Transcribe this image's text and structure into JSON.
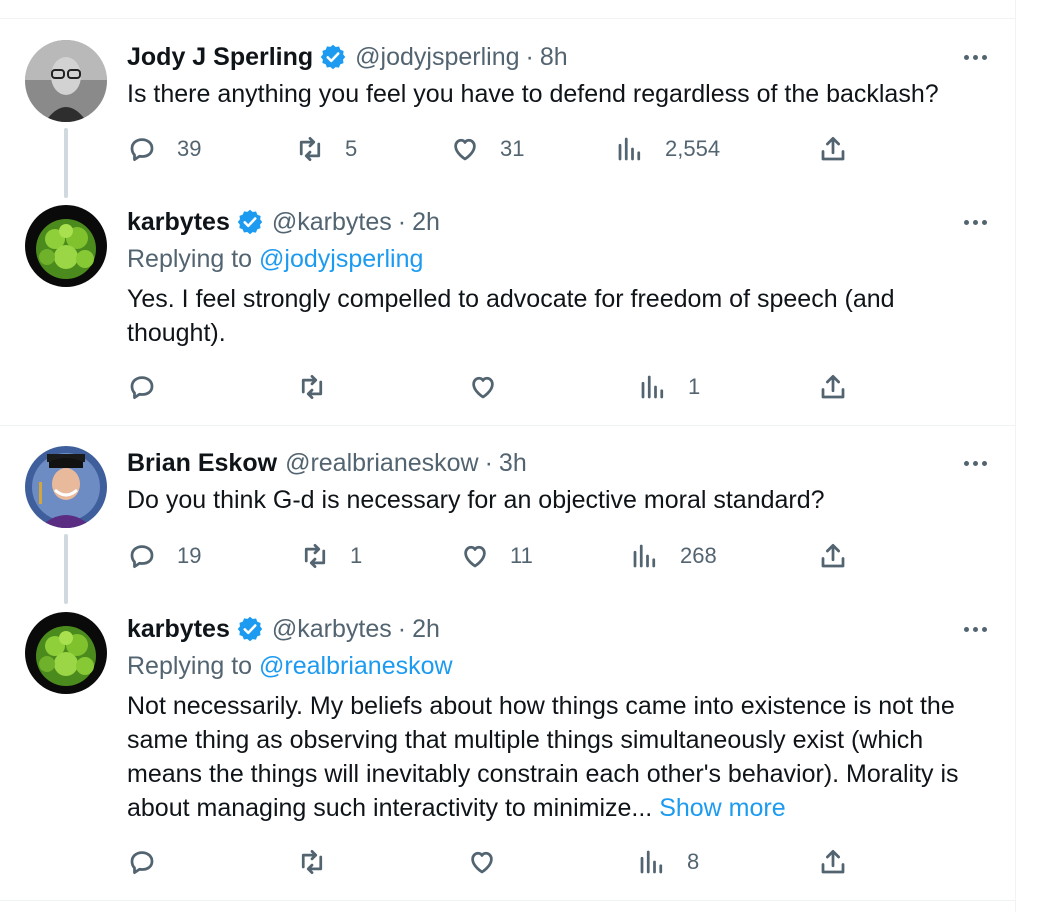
{
  "colors": {
    "link": "#1d9bf0",
    "secondary": "#536471",
    "text": "#0f1419",
    "verified": "#1d9bf0",
    "divider": "#eff3f4"
  },
  "tweets": [
    {
      "name": "Jody J Sperling",
      "verified": true,
      "handle": "@jodyjsperling",
      "time": "8h",
      "text": "Is there anything you feel you have to defend regardless of the backlash?",
      "replies": "39",
      "retweets": "5",
      "likes": "31",
      "views": "2,554"
    },
    {
      "name": "karbytes",
      "verified": true,
      "handle": "@karbytes",
      "time": "2h",
      "replying_prefix": "Replying to",
      "replying_to": "@jodyjsperling",
      "text": "Yes. I feel strongly compelled to advocate for freedom of speech (and thought).",
      "replies": "",
      "retweets": "",
      "likes": "",
      "views": "1"
    },
    {
      "name": "Brian Eskow",
      "verified": false,
      "handle": "@realbrianeskow",
      "time": "3h",
      "text": "Do you think G-d is necessary for an objective moral standard?",
      "replies": "19",
      "retweets": "1",
      "likes": "11",
      "views": "268"
    },
    {
      "name": "karbytes",
      "verified": true,
      "handle": "@karbytes",
      "time": "2h",
      "replying_prefix": "Replying to",
      "replying_to": "@realbrianeskow",
      "text": "Not necessarily. My beliefs about how things came into existence is not the same thing as observing that multiple things simultaneously exist (which means the things will inevitably constrain each other's behavior). Morality is about managing such interactivity to minimize...",
      "show_more": "Show more",
      "replies": "",
      "retweets": "",
      "likes": "",
      "views": "8"
    }
  ],
  "icons": {
    "reply": "reply-icon",
    "retweet": "retweet-icon",
    "like": "heart-icon",
    "views": "analytics-icon",
    "share": "share-icon",
    "more": "more-dots-icon",
    "verified": "verified-badge-icon"
  }
}
